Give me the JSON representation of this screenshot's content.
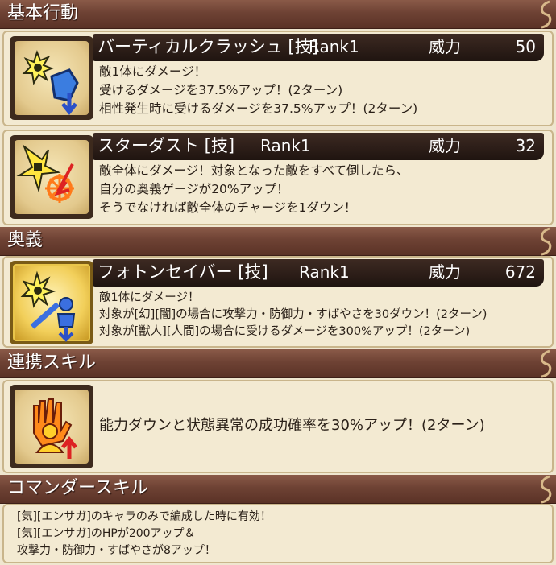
{
  "sections": {
    "basic": "基本行動",
    "ougi": "奥義",
    "renkei": "連携スキル",
    "commander": "コマンダースキル"
  },
  "skills": [
    {
      "name": "バーティカルクラッシュ [技]",
      "rank": "Rank1",
      "power_label": "威力",
      "power": "50",
      "desc": [
        "敵1体にダメージ！",
        "受けるダメージを37.5%アップ！(2ターン)",
        "相性発生時に受けるダメージを37.5%アップ！(2ターン)"
      ],
      "icon": "sword-shield-down-icon"
    },
    {
      "name": "スターダスト [技]",
      "rank": "Rank1",
      "power_label": "威力",
      "power": "32",
      "desc": [
        "敵全体にダメージ！対象となった敵をすべて倒したら、",
        "自分の奥義ゲージが20%アップ！",
        "そうでなければ敵全体のチャージを1ダウン！"
      ],
      "icon": "shuriken-charge-down-icon"
    },
    {
      "name": "フォトンセイバー [技]",
      "rank": "Rank1",
      "power_label": "威力",
      "power": "672",
      "desc": [
        "敵1体にダメージ！",
        "対象が[幻][闇]の場合に攻撃力・防御力・すばやさを30ダウン！(2ターン)",
        "対象が[獣人][人間]の場合に受けるダメージを300%アップ！(2ターン)"
      ],
      "icon": "sword-person-down-icon"
    }
  ],
  "renkei": {
    "desc": "能力ダウンと状態異常の成功確率を30%アップ！(2ターン)",
    "icon": "hand-person-up-icon"
  },
  "commander": {
    "lines": [
      "[気][エンサガ]のキャラのみで編成した時に有効！",
      "[気][エンサガ]のHPが200アップ＆",
      "攻撃力・防御力・すばやさが8アップ！"
    ]
  },
  "colors": {
    "header": "#6e4234",
    "card_bg": "#f3ead2",
    "namebar": "#2a1c16"
  }
}
